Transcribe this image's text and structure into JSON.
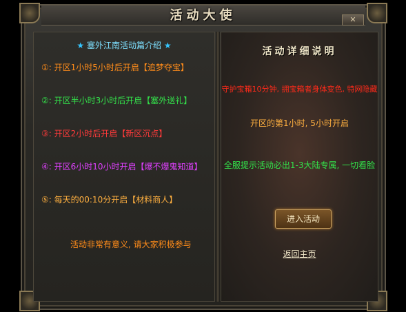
{
  "window": {
    "title": "活动大使",
    "close_label": "✕"
  },
  "left": {
    "header": "塞外江南活动篇介绍",
    "header_star": "★",
    "lines": [
      "①: 开区1小时5小时后开启【追梦夺宝】",
      "②: 开区半小时3小时后开启【塞外送礼】",
      "③: 开区2小时后开启【新区沉点】",
      "④: 开区6小时10小时开启【爆不爆鬼知道】",
      "⑤: 每天的00:10分开启【材料商人】"
    ],
    "footer": "活动非常有意义, 请大家积极参与"
  },
  "right": {
    "header": "活动详细说明",
    "desc1": "守护宝箱10分钟, 拥宝箱者身体变色, 特网隐藏",
    "desc2": "开区的第1小时, 5小时开启",
    "desc3": "全服提示活动必出1-3大陆专属, 一切看脸",
    "enter_button": "进入活动",
    "back_link": "返回主页"
  }
}
